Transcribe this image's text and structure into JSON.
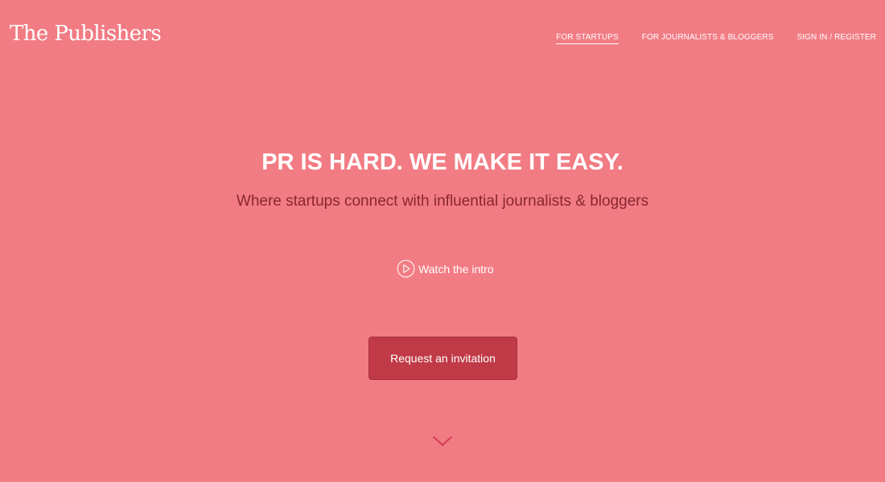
{
  "header": {
    "logo_text": "The Publishers",
    "nav": [
      {
        "label": "FOR STARTUPS",
        "active": true
      },
      {
        "label": "FOR JOURNALISTS & BLOGGERS",
        "active": false
      },
      {
        "label": "SIGN IN / REGISTER",
        "active": false
      }
    ]
  },
  "hero": {
    "title": "PR IS HARD. WE MAKE IT EASY.",
    "subtitle": "Where startups connect with influential journalists & bloggers",
    "watch_label": "Watch the intro",
    "cta_label": "Request an invitation"
  },
  "icons": {
    "play": "play-circle-icon",
    "scroll": "chevron-down-icon"
  },
  "colors": {
    "background": "#f27c84",
    "cta": "#c13a47",
    "subtitle": "#8a2632",
    "chevron": "#d43b52"
  }
}
